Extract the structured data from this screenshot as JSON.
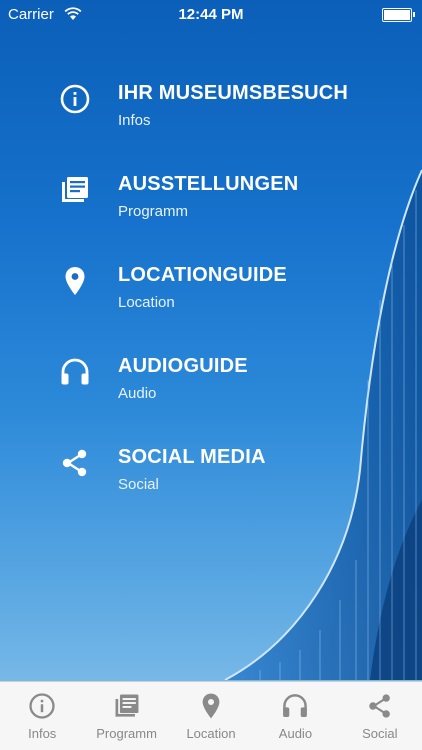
{
  "status_bar": {
    "carrier": "Carrier",
    "time": "12:44 PM"
  },
  "menu": [
    {
      "title": "IHR MUSEUMSBESUCH",
      "subtitle": "Infos",
      "icon": "info-icon"
    },
    {
      "title": "AUSSTELLUNGEN",
      "subtitle": "Programm",
      "icon": "newspaper-icon"
    },
    {
      "title": "LOCATIONGUIDE",
      "subtitle": "Location",
      "icon": "location-pin-icon"
    },
    {
      "title": "AUDIOGUIDE",
      "subtitle": "Audio",
      "icon": "headphones-icon"
    },
    {
      "title": "SOCIAL MEDIA",
      "subtitle": "Social",
      "icon": "share-icon"
    }
  ],
  "tabs": [
    {
      "label": "Infos",
      "icon": "info-icon"
    },
    {
      "label": "Programm",
      "icon": "newspaper-icon"
    },
    {
      "label": "Location",
      "icon": "location-pin-icon"
    },
    {
      "label": "Audio",
      "icon": "headphones-icon"
    },
    {
      "label": "Social",
      "icon": "share-icon"
    }
  ],
  "colors": {
    "tab_icon": "#8a8a8a",
    "menu_text": "#ffffff",
    "tabbar_bg": "#f6f6f6"
  }
}
